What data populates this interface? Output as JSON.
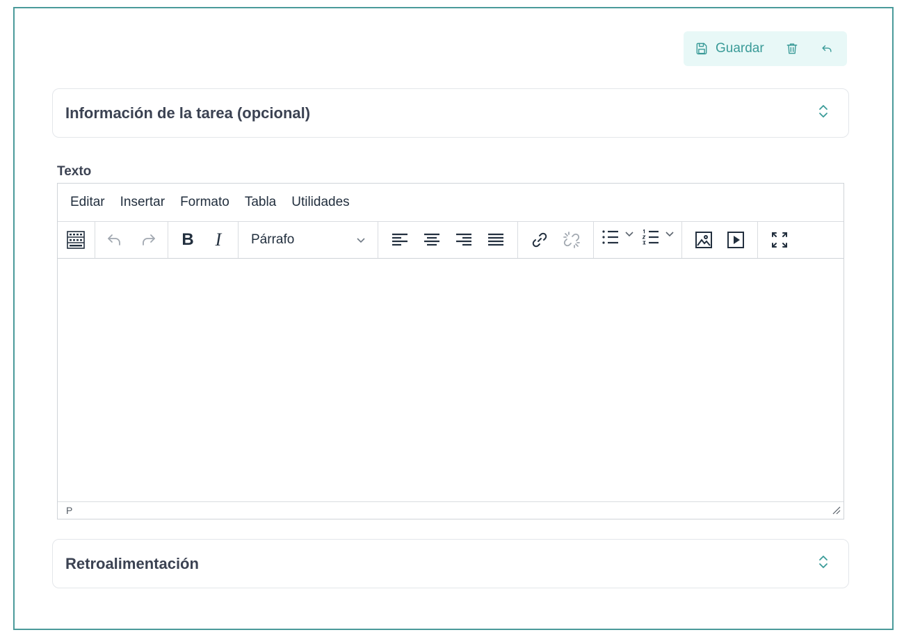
{
  "actions": {
    "save_label": "Guardar",
    "accent": "#3a9b98",
    "background": "#e8f8f7"
  },
  "sections": {
    "info_title": "Información de la tarea (opcional)",
    "feedback_title": "Retroalimentación"
  },
  "field": {
    "label": "Texto"
  },
  "editor": {
    "menus": [
      "Editar",
      "Insertar",
      "Formato",
      "Tabla",
      "Utilidades"
    ],
    "block_format": "Párrafo",
    "status_path": "P",
    "icons": [
      "keyboard-icon",
      "undo-icon",
      "redo-icon",
      "bold-icon",
      "italic-icon",
      "align-left-icon",
      "align-center-icon",
      "align-right-icon",
      "align-justify-icon",
      "link-icon",
      "unlink-icon",
      "bullet-list-icon",
      "numbered-list-icon",
      "image-icon",
      "media-icon",
      "fullscreen-icon"
    ]
  }
}
